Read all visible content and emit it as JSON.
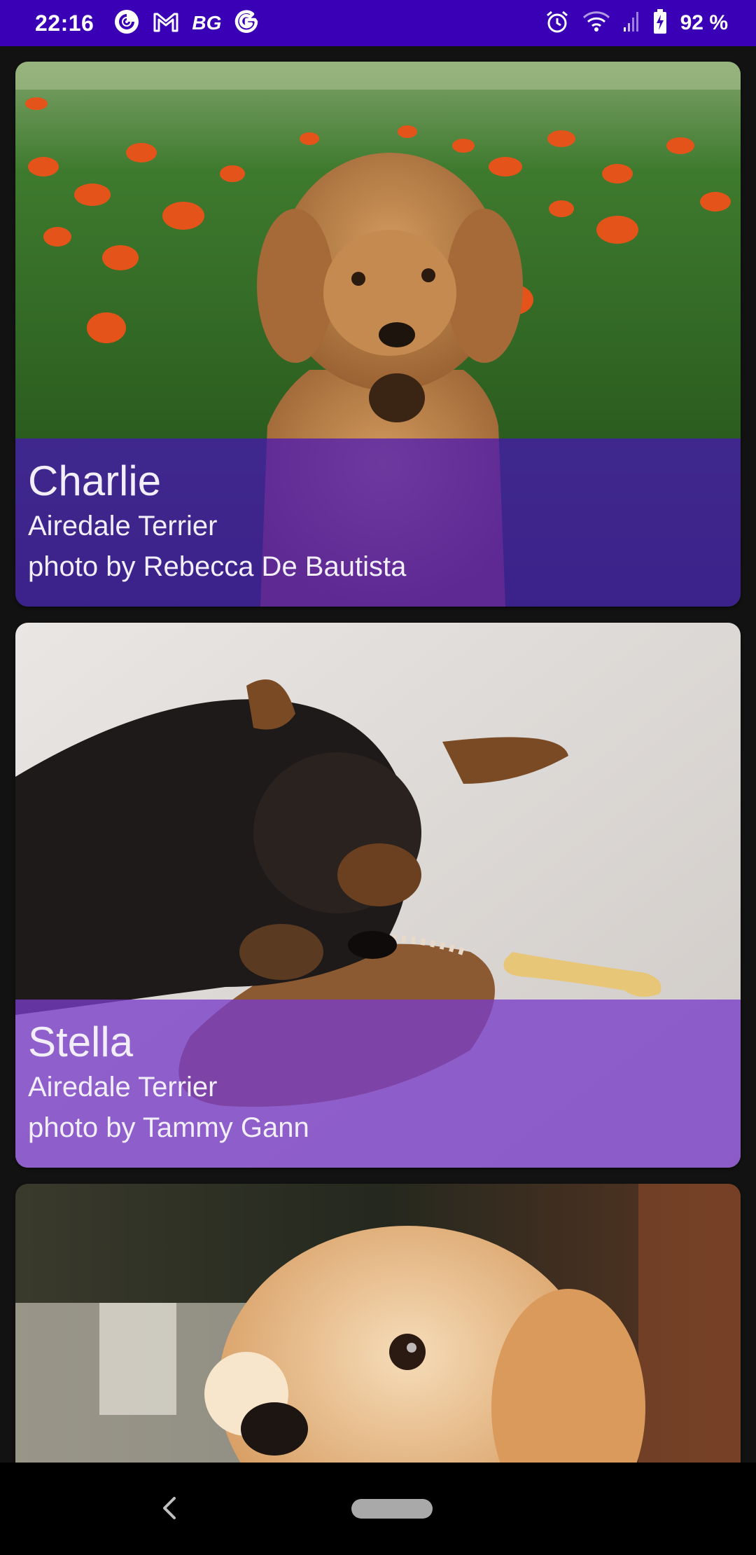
{
  "status_bar": {
    "time": "22:16",
    "left_icons": [
      "pocket-casts-icon",
      "gmail-icon",
      "bg-app-icon",
      "google-icon"
    ],
    "bg_label": "BG",
    "right_icons": [
      "alarm-icon",
      "wifi-icon",
      "signal-icon",
      "battery-charging-icon"
    ],
    "battery": "92 %",
    "background_color": "#3a00b5"
  },
  "dogs": [
    {
      "name": "Charlie",
      "breed": "Airedale Terrier",
      "credit": "photo by Rebecca De Bautista",
      "photo": "curly-dog-in-flower-field",
      "overlay_color": "#4614b9"
    },
    {
      "name": "Stella",
      "breed": "Airedale Terrier",
      "credit": "photo by Tammy Gann",
      "photo": "yorkie-puppy-on-slipper",
      "overlay_color": "#783cc8"
    },
    {
      "photo": "golden-retriever-puppy"
    }
  ],
  "nav_bar": {
    "icons": [
      "back-icon",
      "home-pill"
    ]
  }
}
